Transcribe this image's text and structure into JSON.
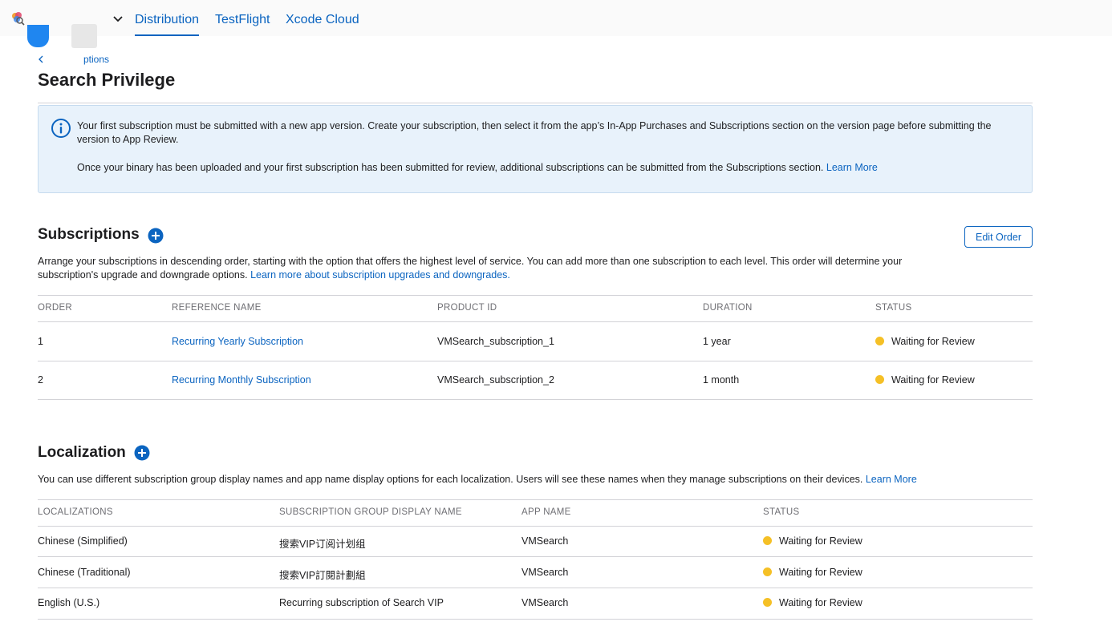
{
  "nav": {
    "tabs": [
      {
        "label": "Distribution",
        "active": true
      },
      {
        "label": "TestFlight",
        "active": false
      },
      {
        "label": "Xcode Cloud",
        "active": false
      }
    ]
  },
  "breadcrumb": {
    "label": "ptions"
  },
  "page": {
    "title": "Search Privilege"
  },
  "info": {
    "p1": "Your first subscription must be submitted with a new app version. Create your subscription, then select it from the app’s In-App Purchases and Subscriptions section on the version page before submitting the version to App Review.",
    "p2": "Once your binary has been uploaded and your first subscription has been submitted for review, additional subscriptions can be submitted from the Subscriptions section.",
    "p2_link": "Learn More"
  },
  "subscriptions": {
    "title": "Subscriptions",
    "edit_label": "Edit Order",
    "desc": "Arrange your subscriptions in descending order, starting with the option that offers the highest level of service. You can add more than one subscription to each level. This order will determine your subscription's upgrade and downgrade options.",
    "desc_link": "Learn more about subscription upgrades and downgrades.",
    "columns": [
      "ORDER",
      "REFERENCE NAME",
      "PRODUCT ID",
      "DURATION",
      "STATUS"
    ],
    "rows": [
      {
        "order": "1",
        "name": "Recurring Yearly Subscription",
        "product_id": "VMSearch_subscription_1",
        "duration": "1 year",
        "status": "Waiting for Review"
      },
      {
        "order": "2",
        "name": "Recurring Monthly Subscription",
        "product_id": "VMSearch_subscription_2",
        "duration": "1 month",
        "status": "Waiting for Review"
      }
    ]
  },
  "localization": {
    "title": "Localization",
    "desc": "You can use different subscription group display names and app name display options for each localization. Users will see these names when they manage subscriptions on their devices.",
    "desc_link": "Learn More",
    "columns": [
      "LOCALIZATIONS",
      "SUBSCRIPTION GROUP DISPLAY NAME",
      "APP NAME",
      "STATUS"
    ],
    "rows": [
      {
        "locale": "Chinese (Simplified)",
        "group_name": "搜索VIP订阅计划组",
        "app_name": "VMSearch",
        "status": "Waiting for Review"
      },
      {
        "locale": "Chinese (Traditional)",
        "group_name": "搜索VIP訂閱計劃組",
        "app_name": "VMSearch",
        "status": "Waiting for Review"
      },
      {
        "locale": "English (U.S.)",
        "group_name": "Recurring subscription of Search VIP",
        "app_name": "VMSearch",
        "status": "Waiting for Review"
      }
    ]
  },
  "colors": {
    "accent": "#0b64c0",
    "status_pending": "#f5c026",
    "info_bg": "#e8f2fb"
  },
  "icons": [
    "app-logo-icon",
    "chevron-down-icon",
    "chevron-left-icon",
    "info-icon",
    "add-circle-icon"
  ]
}
